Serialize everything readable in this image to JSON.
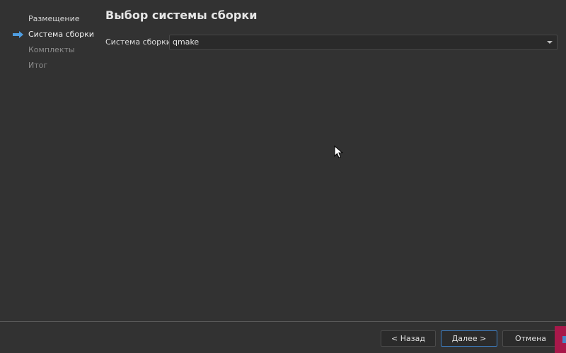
{
  "wizard": {
    "title": "Выбор системы сборки",
    "steps": [
      {
        "label": "Размещение",
        "state": "done"
      },
      {
        "label": "Система сборки",
        "state": "current"
      },
      {
        "label": "Комплекты",
        "state": "pending"
      },
      {
        "label": "Итог",
        "state": "pending"
      }
    ],
    "build_system": {
      "label": "Система сборки:",
      "value": "qmake"
    },
    "buttons": {
      "back": "< Назад",
      "next": "Далее >",
      "cancel": "Отмена"
    }
  },
  "icons": {
    "current_step": "arrow-right-icon",
    "combo": "chevron-down-icon",
    "cursor": "mouse-pointer-icon"
  },
  "colors": {
    "background": "#323232",
    "accent": "#4f9de0",
    "focus_border": "#3d7fc4",
    "corner_badge": "#a8184a"
  }
}
